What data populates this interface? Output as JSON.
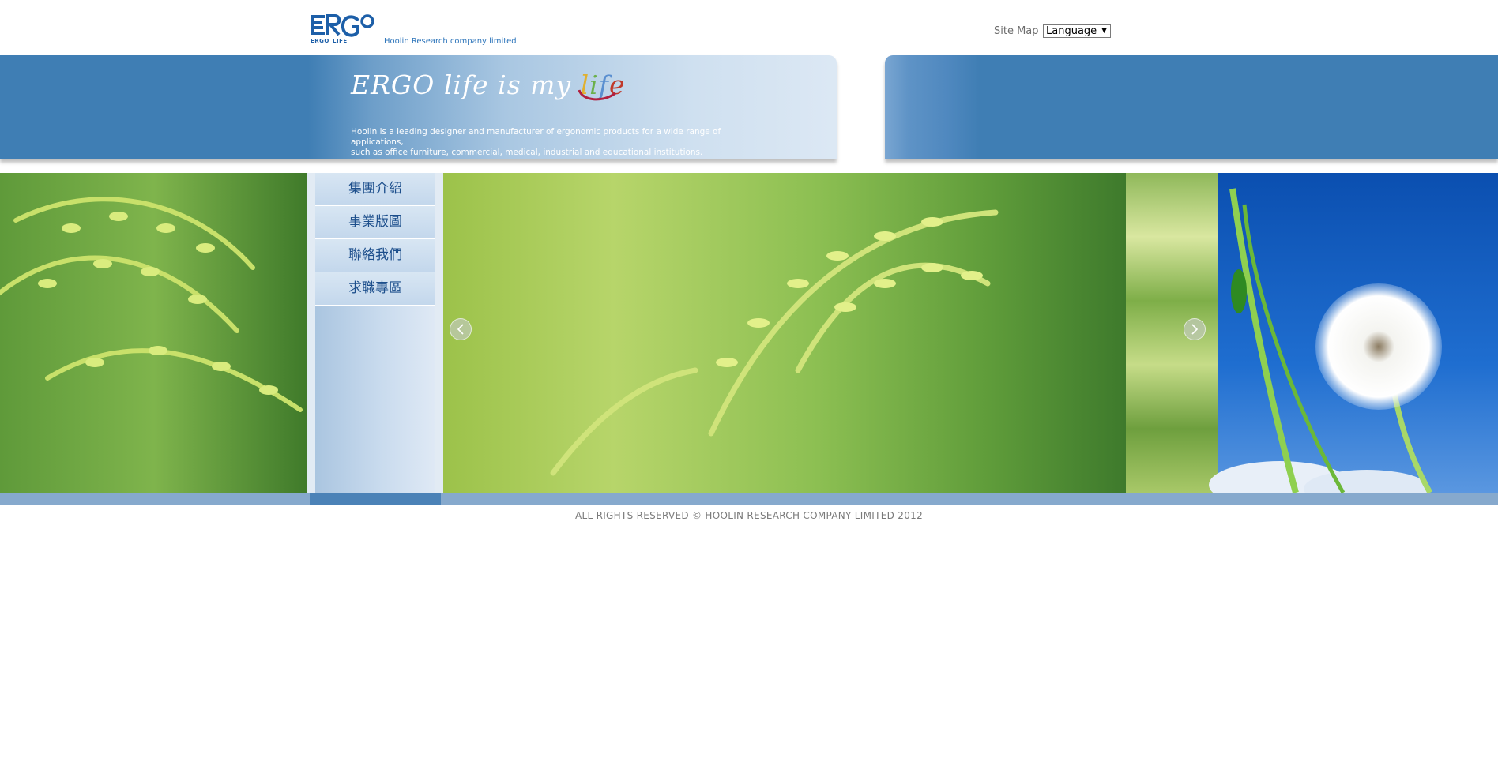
{
  "header": {
    "logo_word": "ERGO",
    "logo_small_left": "ERGO",
    "logo_small_right": "LIFE",
    "logo_tagline": "Hoolin Research company limited",
    "site_map_label": "Site Map",
    "language_select": {
      "selected": "Language"
    }
  },
  "banner": {
    "slogan": "ERGO life is my ",
    "slogan_word": {
      "l": "l",
      "i": "i",
      "f": "f",
      "e": "e"
    },
    "description_line1": "Hoolin is a leading designer and manufacturer of ergonomic products for a wide range of applications,",
    "description_line2": "such as office furniture, commercial, medical, industrial and educational institutions."
  },
  "sidebar": {
    "items": [
      {
        "label": "集團介紹"
      },
      {
        "label": "事業版圖"
      },
      {
        "label": "聯絡我們"
      },
      {
        "label": "求職專區"
      }
    ]
  },
  "slideshow": {
    "prev_icon": "chevron-left-icon",
    "next_icon": "chevron-right-icon",
    "images": [
      "rice-plant-photo",
      "dandelion-photo"
    ]
  },
  "footer": {
    "copyright": "ALL RIGHTS RESERVED © HOOLIN RESEARCH COMPANY LIMITED 2012"
  },
  "colors": {
    "brand_blue": "#3f7eb4",
    "menu_text": "#1d4f8c",
    "bottom_bar": "#86a9cd"
  }
}
